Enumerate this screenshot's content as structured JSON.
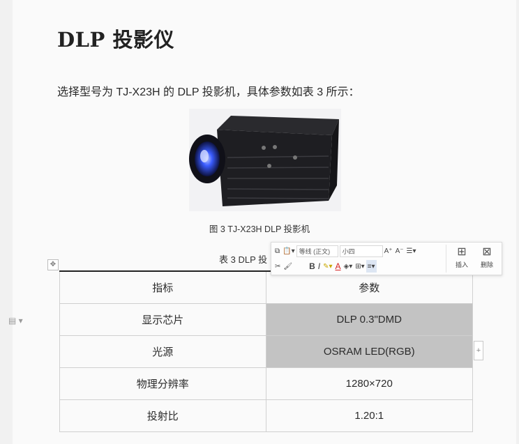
{
  "document": {
    "heading": "DLP 投影仪",
    "paragraph": "选择型号为 TJ-X23H 的 DLP 投影机，具体参数如表 3 所示：",
    "figure_caption": "图 3 TJ-X23H DLP 投影机",
    "table_caption": "表 3 DLP 投",
    "table": {
      "headers": [
        "指标",
        "参数"
      ],
      "rows": [
        [
          "显示芯片",
          "DLP 0.3\"DMD"
        ],
        [
          "光源",
          "OSRAM LED(RGB)"
        ],
        [
          "物理分辨率",
          "1280×720"
        ],
        [
          "投射比",
          "1.20:1"
        ]
      ]
    }
  },
  "mini_toolbar": {
    "font_name": "等线 (正文)",
    "font_size": "小四",
    "insert_label": "插入",
    "delete_label": "删除",
    "bold": "B",
    "italic": "I",
    "font_color": "A"
  },
  "colors": {
    "page_bg": "#fafafa",
    "selection": "#c3c3c3",
    "projector_light": "#3a5cff"
  }
}
